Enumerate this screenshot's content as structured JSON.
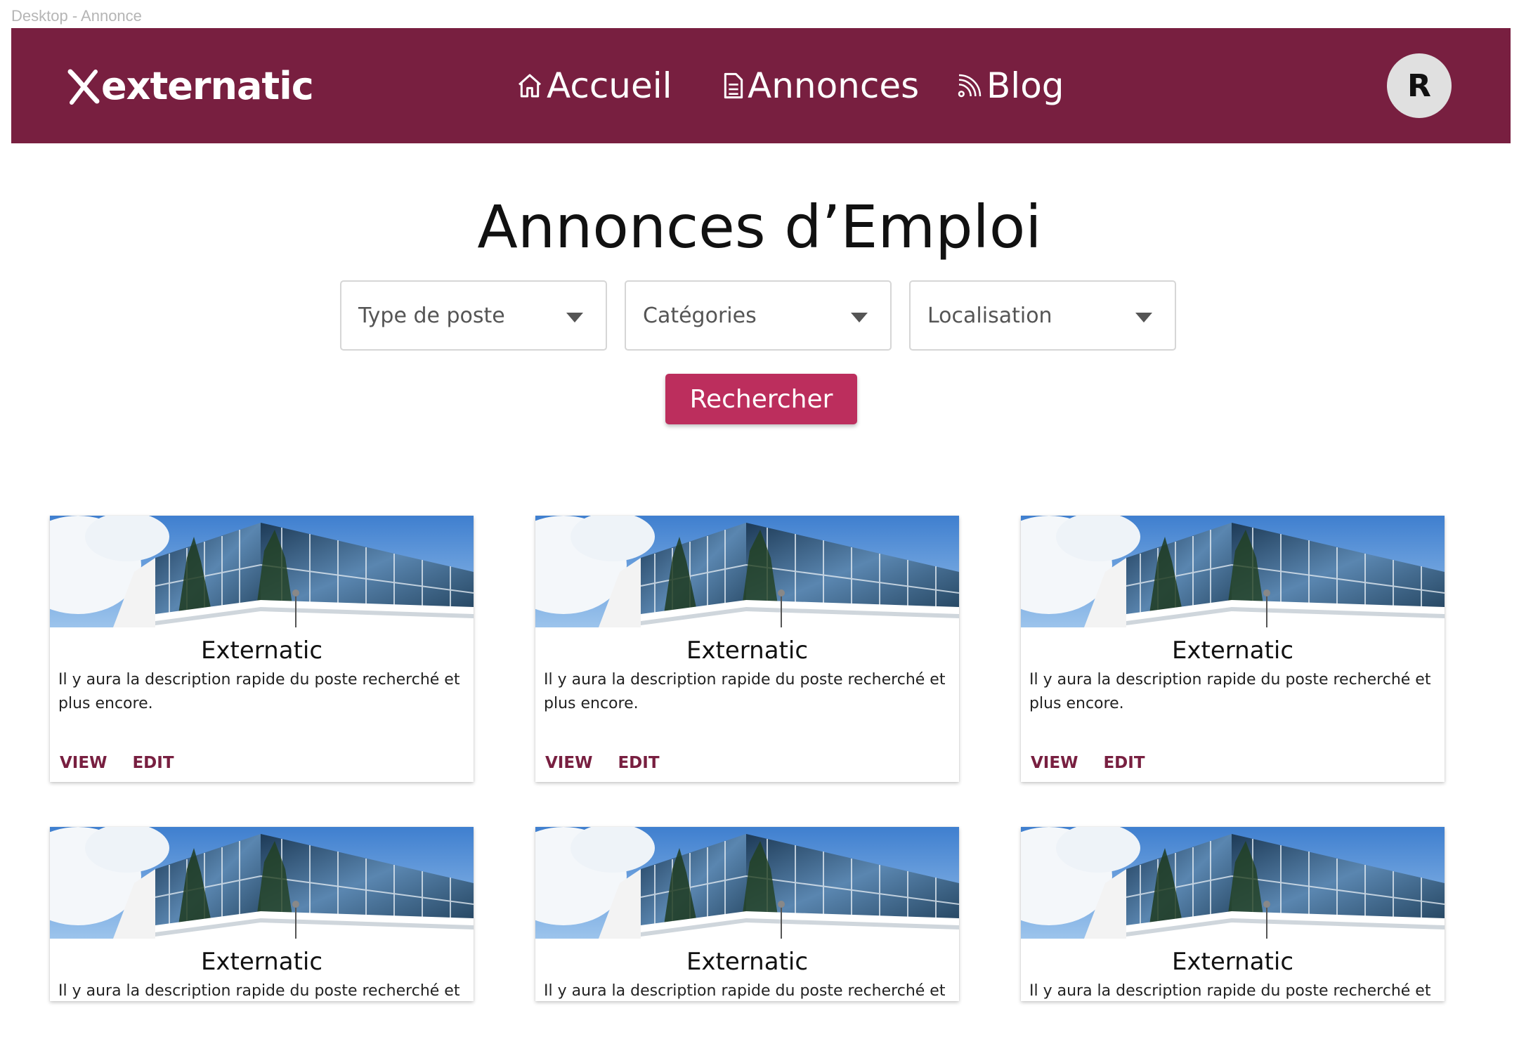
{
  "frame": {
    "label": "Desktop - Annonce"
  },
  "header": {
    "logo_text": "externatic",
    "nav": [
      {
        "label": "Accueil",
        "icon": "home-icon"
      },
      {
        "label": "Annonces",
        "icon": "document-icon"
      },
      {
        "label": "Blog",
        "icon": "rss-icon"
      }
    ],
    "avatar_initial": "R"
  },
  "colors": {
    "header_bg": "#781f40",
    "button_bg": "#bc2e5d",
    "action_text": "#781f40",
    "avatar_bg": "#e0e0e0"
  },
  "main": {
    "title": "Annonces d’Emploi",
    "filters": [
      {
        "placeholder": "Type de poste"
      },
      {
        "placeholder": "Catégories"
      },
      {
        "placeholder": "Localisation"
      }
    ],
    "search_label": "Rechercher"
  },
  "cards": [
    {
      "title": "Externatic",
      "description": "Il y aura la description rapide du poste recherché et plus encore.",
      "view": "VIEW",
      "edit": "EDIT"
    },
    {
      "title": "Externatic",
      "description": "Il y aura la description rapide du poste recherché et plus encore.",
      "view": "VIEW",
      "edit": "EDIT"
    },
    {
      "title": "Externatic",
      "description": "Il y aura la description rapide du poste recherché et plus encore.",
      "view": "VIEW",
      "edit": "EDIT"
    },
    {
      "title": "Externatic",
      "description": "Il y aura la description rapide du poste recherché et plus"
    },
    {
      "title": "Externatic",
      "description": "Il y aura la description rapide du poste recherché et plus"
    },
    {
      "title": "Externatic",
      "description": "Il y aura la description rapide du poste recherché et plus"
    }
  ]
}
